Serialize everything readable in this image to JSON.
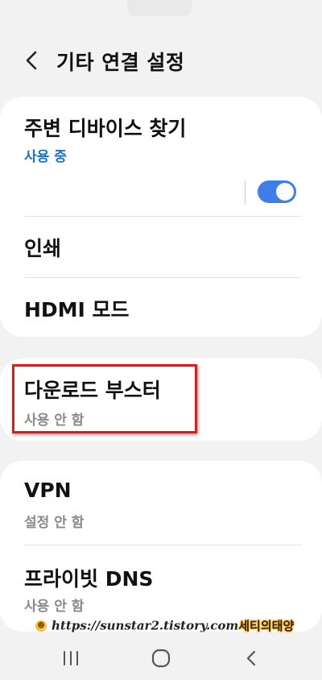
{
  "header": {
    "title": "기타 연결 설정",
    "back_icon": "chevron-left-icon"
  },
  "sections": {
    "nearby": {
      "title": "주변 디바이스 찾기",
      "status": "사용 중",
      "status_color": "#1a73c8",
      "toggle_on": true,
      "toggle_color": "#3e7ee6"
    },
    "print": {
      "title": "인쇄"
    },
    "hdmi": {
      "title": "HDMI 모드"
    },
    "download_booster": {
      "title": "다운로드 부스터",
      "status": "사용 안 함",
      "highlighted": true,
      "highlight_color": "#d51f1f"
    },
    "vpn": {
      "title": "VPN",
      "status": "설정 안 함"
    },
    "private_dns": {
      "title": "프라이빗 DNS",
      "status": "사용 안 함"
    }
  },
  "watermark": {
    "url": "https://sunstar2.tistory.com",
    "name": "세티의태양"
  },
  "navbar": {
    "recents_icon": "recent-apps-icon",
    "home_icon": "home-icon",
    "back_icon": "back-icon"
  }
}
